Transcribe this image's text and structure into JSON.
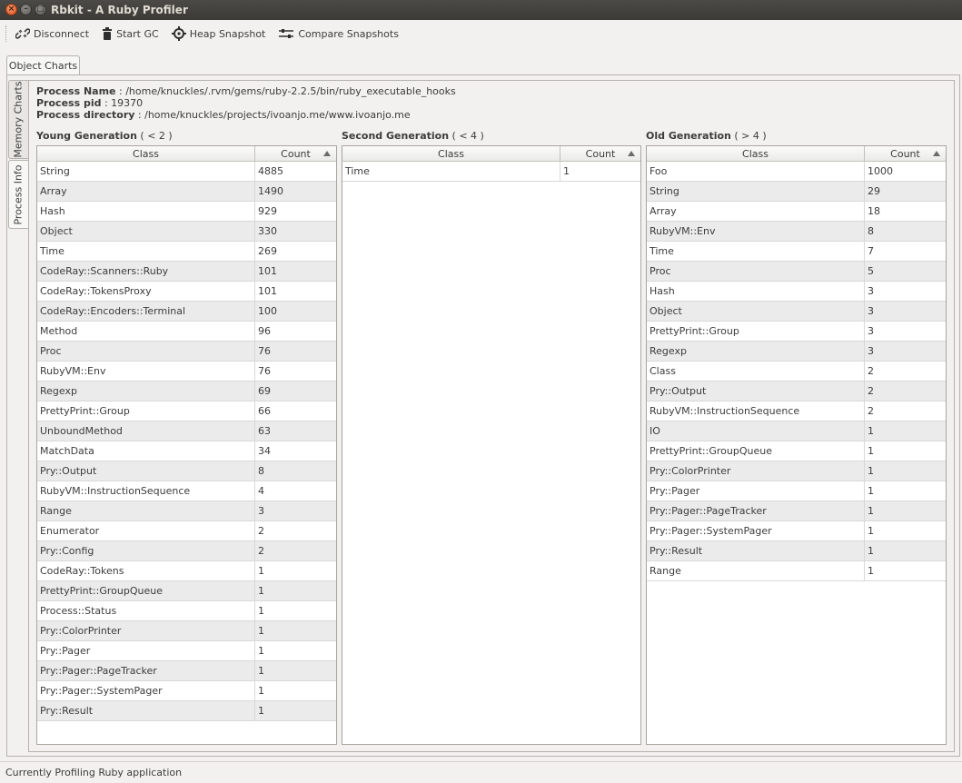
{
  "window": {
    "title": "Rbkit - A Ruby Profiler"
  },
  "toolbar": {
    "disconnect": "Disconnect",
    "start_gc": "Start GC",
    "heap_snapshot": "Heap Snapshot",
    "compare_snapshots": "Compare  Snapshots"
  },
  "tabs": {
    "object_charts": "Object Charts",
    "memory_charts": "Memory Charts",
    "process_info": "Process Info"
  },
  "process": {
    "name_label": "Process Name",
    "name_value": " : /home/knuckles/.rvm/gems/ruby-2.2.5/bin/ruby_executable_hooks",
    "pid_label": "Process pid",
    "pid_value": " : 19370",
    "dir_label": "Process directory",
    "dir_value": " : /home/knuckles/projects/ivoanjo.me/www.ivoanjo.me"
  },
  "columns": {
    "class": "Class",
    "count": "Count"
  },
  "young": {
    "title": "Young Generation",
    "range": " ( < 2 )",
    "rows": [
      [
        "String",
        "4885"
      ],
      [
        "Array",
        "1490"
      ],
      [
        "Hash",
        "929"
      ],
      [
        "Object",
        "330"
      ],
      [
        "Time",
        "269"
      ],
      [
        "CodeRay::Scanners::Ruby",
        "101"
      ],
      [
        "CodeRay::TokensProxy",
        "101"
      ],
      [
        "CodeRay::Encoders::Terminal",
        "100"
      ],
      [
        "Method",
        "96"
      ],
      [
        "Proc",
        "76"
      ],
      [
        "RubyVM::Env",
        "76"
      ],
      [
        "Regexp",
        "69"
      ],
      [
        "PrettyPrint::Group",
        "66"
      ],
      [
        "UnboundMethod",
        "63"
      ],
      [
        "MatchData",
        "34"
      ],
      [
        "Pry::Output",
        "8"
      ],
      [
        "RubyVM::InstructionSequence",
        "4"
      ],
      [
        "Range",
        "3"
      ],
      [
        "Enumerator",
        "2"
      ],
      [
        "Pry::Config",
        "2"
      ],
      [
        "CodeRay::Tokens",
        "1"
      ],
      [
        "PrettyPrint::GroupQueue",
        "1"
      ],
      [
        "Process::Status",
        "1"
      ],
      [
        "Pry::ColorPrinter",
        "1"
      ],
      [
        "Pry::Pager",
        "1"
      ],
      [
        "Pry::Pager::PageTracker",
        "1"
      ],
      [
        "Pry::Pager::SystemPager",
        "1"
      ],
      [
        "Pry::Result",
        "1"
      ]
    ]
  },
  "second": {
    "title": "Second Generation",
    "range": " ( < 4 )",
    "rows": [
      [
        "Time",
        "1"
      ]
    ]
  },
  "old": {
    "title": "Old Generation",
    "range": " ( > 4 )",
    "rows": [
      [
        "Foo",
        "1000"
      ],
      [
        "String",
        "29"
      ],
      [
        "Array",
        "18"
      ],
      [
        "RubyVM::Env",
        "8"
      ],
      [
        "Time",
        "7"
      ],
      [
        "Proc",
        "5"
      ],
      [
        "Hash",
        "3"
      ],
      [
        "Object",
        "3"
      ],
      [
        "PrettyPrint::Group",
        "3"
      ],
      [
        "Regexp",
        "3"
      ],
      [
        "Class",
        "2"
      ],
      [
        "Pry::Output",
        "2"
      ],
      [
        "RubyVM::InstructionSequence",
        "2"
      ],
      [
        "IO",
        "1"
      ],
      [
        "PrettyPrint::GroupQueue",
        "1"
      ],
      [
        "Pry::ColorPrinter",
        "1"
      ],
      [
        "Pry::Pager",
        "1"
      ],
      [
        "Pry::Pager::PageTracker",
        "1"
      ],
      [
        "Pry::Pager::SystemPager",
        "1"
      ],
      [
        "Pry::Result",
        "1"
      ],
      [
        "Range",
        "1"
      ]
    ]
  },
  "status": {
    "text": "Currently Profiling Ruby application"
  }
}
